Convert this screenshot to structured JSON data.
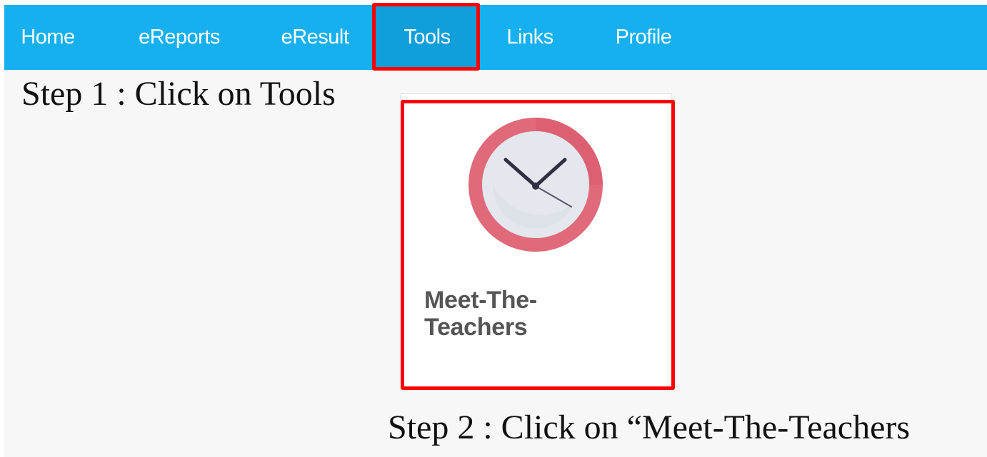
{
  "navbar": {
    "items": [
      {
        "label": "Home"
      },
      {
        "label": "eReports"
      },
      {
        "label": "eResult"
      },
      {
        "label": "Tools",
        "active": true
      },
      {
        "label": "Links"
      },
      {
        "label": "Profile"
      }
    ],
    "bg_color": "#16b0f0",
    "active_bg_color": "#119fdb"
  },
  "instructions": {
    "step1": "Step 1 : Click on Tools",
    "step2": "Step 2 : Click on “Meet-The-Teachers"
  },
  "tool_tile": {
    "label": "Meet-The-\nTeachers",
    "icon": "clock-icon"
  },
  "highlight_color": "#ff0000"
}
